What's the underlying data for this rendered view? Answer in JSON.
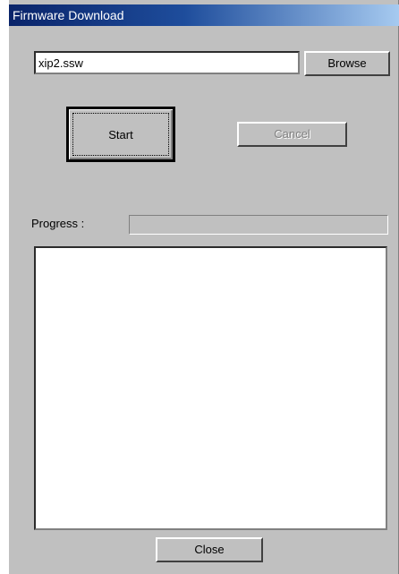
{
  "window": {
    "title": "Firmware Download"
  },
  "file_field": {
    "value": "xip2.ssw"
  },
  "buttons": {
    "browse": "Browse",
    "start": "Start",
    "cancel": "Cancel",
    "close": "Close"
  },
  "progress": {
    "label": "Progress :",
    "value_percent": 0
  },
  "log": {
    "content": ""
  },
  "colors": {
    "face": "#c0c0c0",
    "title_gradient_start": "#0a246a",
    "title_gradient_end": "#a6caf0",
    "disabled_text": "#808080"
  }
}
